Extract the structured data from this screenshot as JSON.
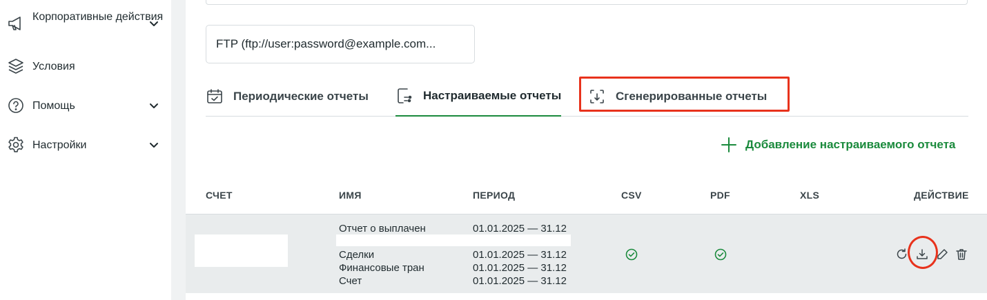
{
  "sidebar": {
    "items": [
      {
        "label": "Корпоративные действия",
        "icon": "megaphone-icon",
        "expandable": true
      },
      {
        "label": "Условия",
        "icon": "layers-icon",
        "expandable": false
      },
      {
        "label": "Помощь",
        "icon": "help-circle-icon",
        "expandable": true
      },
      {
        "label": "Настройки",
        "icon": "gear-icon",
        "expandable": true
      }
    ]
  },
  "delivery": {
    "ftp_value": "FTP (ftp://user:password@example.com..."
  },
  "tabs": [
    {
      "label": "Периодические отчеты",
      "icon": "calendar-check-icon",
      "active": false
    },
    {
      "label": "Настраиваемые отчеты",
      "icon": "custom-report-icon",
      "active": true
    },
    {
      "label": "Сгенерированные отчеты",
      "icon": "generated-report-icon",
      "active": false,
      "highlighted": true
    }
  ],
  "add_button": {
    "label": "Добавление настраиваемого отчета"
  },
  "table": {
    "headers": {
      "account": "СЧЕТ",
      "name": "ИМЯ",
      "period": "ПЕРИОД",
      "csv": "CSV",
      "pdf": "PDF",
      "xls": "XLS",
      "action": "ДЕЙСТВИЕ"
    },
    "row": {
      "names": [
        "Отчет о выплачен",
        "",
        "Сделки",
        "Финансовые тран",
        "Счет"
      ],
      "periods": [
        "01.01.2025 — 31.12",
        "",
        "01.01.2025 — 31.12",
        "01.01.2025 — 31.12",
        "01.01.2025 — 31.12"
      ],
      "csv": true,
      "pdf": true,
      "xls": false
    }
  },
  "colors": {
    "accent": "#1a8a3c",
    "highlight": "#e8321c"
  }
}
